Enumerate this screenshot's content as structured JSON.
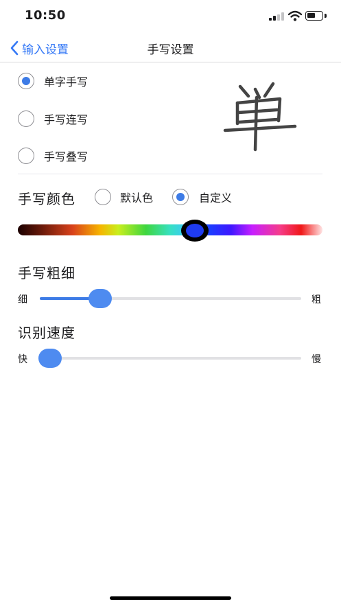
{
  "status_bar": {
    "time": "10:50",
    "signal_icon": "cellular-signal-icon",
    "wifi_icon": "wifi-icon",
    "battery_icon": "battery-icon"
  },
  "nav": {
    "back_label": "输入设置",
    "title": "手写设置",
    "back_icon": "chevron-left-icon"
  },
  "modes": [
    {
      "label": "单字手写",
      "selected": true
    },
    {
      "label": "手写连写",
      "selected": false
    },
    {
      "label": "手写叠写",
      "selected": false
    }
  ],
  "preview": {
    "glyph": "単"
  },
  "color": {
    "title": "手写颜色",
    "options": [
      {
        "label": "默认色",
        "selected": false
      },
      {
        "label": "自定义",
        "selected": true
      }
    ],
    "selected_hue_fraction": 0.58,
    "selected_color": "#1f3bf0"
  },
  "thickness": {
    "title": "手写粗细",
    "min_label": "细",
    "max_label": "粗",
    "value_fraction": 0.23
  },
  "speed": {
    "title": "识别速度",
    "min_label": "快",
    "max_label": "慢",
    "value_fraction": 0.04
  },
  "colors": {
    "accent": "#3d7be6",
    "nav_link": "#3478f6"
  }
}
